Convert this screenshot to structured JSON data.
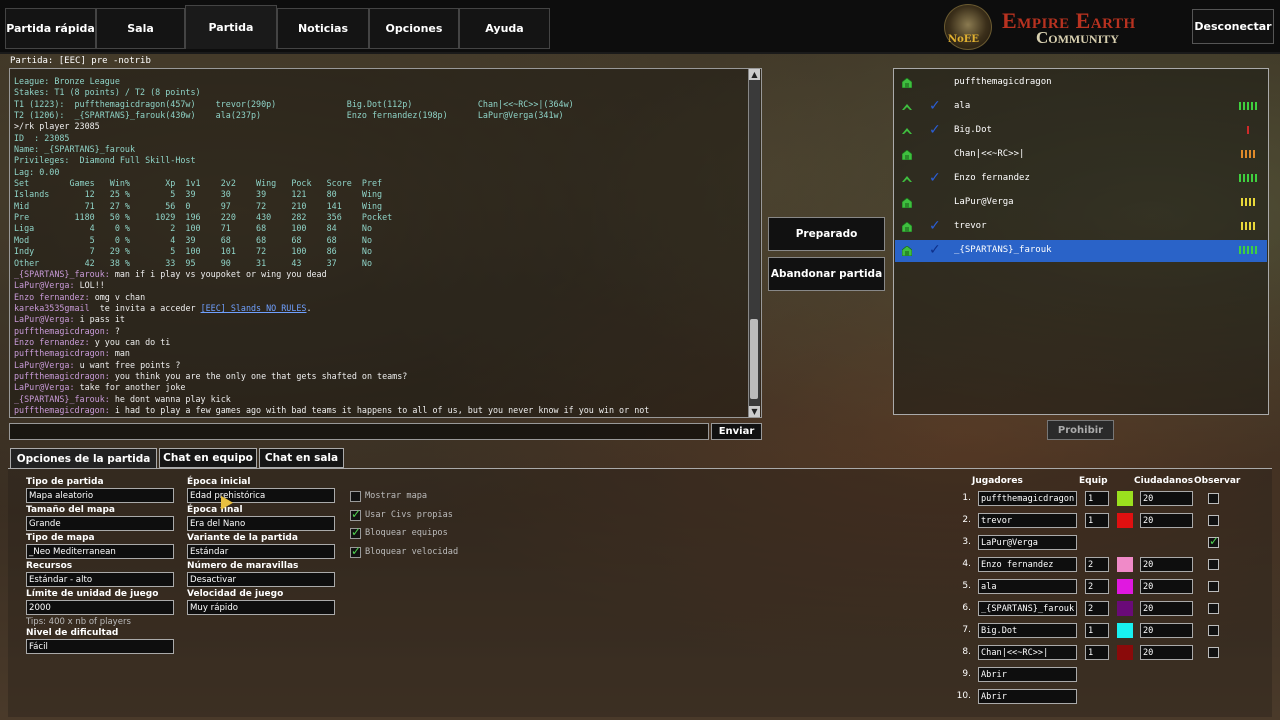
{
  "nav": {
    "tabs": [
      "Partida rápida",
      "Sala",
      "Partida",
      "Noticias",
      "Opciones",
      "Ayuda"
    ],
    "active_tab": "Partida",
    "logo_line1": "Empire Earth",
    "logo_line2": "Community",
    "logo_badge": "NoEE",
    "disconnect_label": "Desconectar"
  },
  "chat": {
    "title": "Partida: [EEC] pre -notrib",
    "lines": [
      [
        [
          "sys",
          "League: Bronze League"
        ]
      ],
      [
        [
          "sys",
          "Stakes: T1 (8 points) / T2 (8 points)"
        ]
      ],
      [
        [
          "sys",
          "T1 (1223):  puffthemagicdragon(457w)    trevor(290p)              Big.Dot(112p)             Chan|<<~RC>>|(364w)"
        ]
      ],
      [
        [
          "sys",
          "T2 (1206):  _{SPARTANS}_farouk(430w)    ala(237p)                 Enzo fernandez(198p)      LaPur@Verga(341w)"
        ]
      ],
      [
        [
          "msg",
          ">/rk player 23085"
        ]
      ],
      [
        [
          "sys",
          "ID  : 23085"
        ]
      ],
      [
        [
          "sys",
          "Name: _{SPARTANS}_farouk"
        ]
      ],
      [
        [
          "sys",
          "Privileges:  Diamond Full Skill-Host"
        ]
      ],
      [
        [
          "sys",
          "Lag: 0.00"
        ]
      ],
      [
        [
          "sys",
          "Set        Games   Win%       Xp  1v1    2v2    Wing   Pock   Score  Pref"
        ]
      ],
      [
        [
          "sys",
          "Islands       12   25 %        5  39     30     39     121    80     Wing"
        ]
      ],
      [
        [
          "sys",
          "Mid           71   27 %       56  0      97     72     210    141    Wing"
        ]
      ],
      [
        [
          "sys",
          "Pre         1180   50 %     1029  196    220    430    282    356    Pocket"
        ]
      ],
      [
        [
          "sys",
          "Liga           4    0 %        2  100    71     68     100    84     No"
        ]
      ],
      [
        [
          "sys",
          "Mod            5    0 %        4  39     68     68     68     68     No"
        ]
      ],
      [
        [
          "sys",
          "Indy           7   29 %        5  100    101    72     100    86     No"
        ]
      ],
      [
        [
          "sys",
          "Other         42   38 %       33  95     90     31     43     37     No"
        ]
      ],
      [
        [
          "nick",
          "_{SPARTANS}_farouk: "
        ],
        [
          "msg",
          "man if i play vs youpoket or wing you dead"
        ]
      ],
      [
        [
          "nick",
          "LaPur@Verga: "
        ],
        [
          "msg",
          "LOL!!"
        ]
      ],
      [
        [
          "nick",
          "Enzo fernandez: "
        ],
        [
          "msg",
          "omg v chan"
        ]
      ],
      [
        [
          "nick",
          "kareka3535gmail "
        ],
        [
          "msg",
          " te invita a acceder "
        ],
        [
          "link",
          "[EEC] Slands NO RULES"
        ],
        [
          "msg",
          "."
        ]
      ],
      [
        [
          "nick",
          "LaPur@Verga: "
        ],
        [
          "msg",
          "i pass it"
        ]
      ],
      [
        [
          "nick",
          "puffthemagicdragon: "
        ],
        [
          "msg",
          "?"
        ]
      ],
      [
        [
          "nick",
          "Enzo fernandez: "
        ],
        [
          "msg",
          "y you can do ti"
        ]
      ],
      [
        [
          "nick",
          "puffthemagicdragon: "
        ],
        [
          "msg",
          "man"
        ]
      ],
      [
        [
          "nick",
          "LaPur@Verga: "
        ],
        [
          "msg",
          "u want free points ?"
        ]
      ],
      [
        [
          "nick",
          "puffthemagicdragon: "
        ],
        [
          "msg",
          "you think you are the only one that gets shafted on teams?"
        ]
      ],
      [
        [
          "nick",
          "LaPur@Verga: "
        ],
        [
          "msg",
          "take for another joke"
        ]
      ],
      [
        [
          "nick",
          "_{SPARTANS}_farouk: "
        ],
        [
          "msg",
          "he dont wanna play kick"
        ]
      ],
      [
        [
          "nick",
          "puffthemagicdragon: "
        ],
        [
          "msg",
          "i had to play a few games ago with bad teams it happens to all of us, but you never know if you win or not"
        ]
      ]
    ],
    "input_value": "",
    "send_label": "Enviar"
  },
  "actions": {
    "ready_label": "Preparado",
    "leave_label": "Abandonar partida",
    "prohibit_label": "Prohibir"
  },
  "players": [
    {
      "name": "puffthemagicdragon",
      "icon": "host",
      "checked": false,
      "bars": "",
      "bar_color": ""
    },
    {
      "name": "ala",
      "icon": "peer",
      "checked": true,
      "bars": "5",
      "bar_color": "#3fd03f"
    },
    {
      "name": "Big.Dot",
      "icon": "peer",
      "checked": true,
      "bars": "1",
      "bar_color": "#d02a2a"
    },
    {
      "name": "Chan|<<~RC>>|",
      "icon": "host",
      "checked": false,
      "bars": "4",
      "bar_color": "#e08a2a"
    },
    {
      "name": "Enzo fernandez",
      "icon": "peer",
      "checked": true,
      "bars": "5",
      "bar_color": "#3fd03f"
    },
    {
      "name": "LaPur@Verga",
      "icon": "host",
      "checked": false,
      "bars": "4",
      "bar_color": "#e8d83a"
    },
    {
      "name": "trevor",
      "icon": "host",
      "checked": true,
      "bars": "4",
      "bar_color": "#e8d83a"
    },
    {
      "name": "_{SPARTANS}_farouk",
      "icon": "host",
      "checked": true,
      "bars": "5",
      "bar_color": "#3fd03f",
      "selected": true
    }
  ],
  "bottom_tabs": [
    "Opciones de la partida",
    "Chat en equipo",
    "Chat en sala"
  ],
  "options": {
    "col1": [
      {
        "label": "Tipo de partida",
        "value": "Mapa aleatorio"
      },
      {
        "label": "Tamaño del mapa",
        "value": "Grande"
      },
      {
        "label": "Tipo de mapa",
        "value": "_Neo Mediterranean"
      },
      {
        "label": "Recursos",
        "value": "Estándar - alto"
      },
      {
        "label": "Límite de unidad de juego",
        "value": "2000"
      },
      {
        "label": "Nivel de dificultad",
        "value": "Fácil"
      }
    ],
    "tips": "Tips: 400 x nb of players",
    "col2": [
      {
        "label": "Época inicial",
        "value": "Edad prehistórica"
      },
      {
        "label": "Época final",
        "value": "Era del Nano"
      },
      {
        "label": "Variante de la partida",
        "value": "Estándar"
      },
      {
        "label": "Número de maravillas",
        "value": "Desactivar"
      },
      {
        "label": "Velocidad de juego",
        "value": "Muy rápido"
      }
    ],
    "checks": [
      {
        "label": "Mostrar mapa",
        "checked": false
      },
      {
        "label": "Usar Civs propias",
        "checked": true
      },
      {
        "label": "Bloquear equipos",
        "checked": true
      },
      {
        "label": "Bloquear velocidad",
        "checked": true
      }
    ]
  },
  "roster": {
    "headers": {
      "players": "Jugadores",
      "team": "Equip",
      "citizens": "Ciudadanos",
      "observe": "Observar"
    },
    "rows": [
      {
        "num": "1.",
        "name": "puffthemagicdragon",
        "team": "1",
        "color": "#9be01e",
        "pop": "20",
        "observe": false
      },
      {
        "num": "2.",
        "name": "trevor",
        "team": "1",
        "color": "#e01010",
        "pop": "20",
        "observe": false
      },
      {
        "num": "3.",
        "name": "LaPur@Verga",
        "team": "",
        "color": "",
        "pop": "",
        "observe": true
      },
      {
        "num": "4.",
        "name": "Enzo fernandez",
        "team": "2",
        "color": "#f08ac8",
        "pop": "20",
        "observe": false
      },
      {
        "num": "5.",
        "name": "ala",
        "team": "2",
        "color": "#e018e0",
        "pop": "20",
        "observe": false
      },
      {
        "num": "6.",
        "name": "_{SPARTANS}_farouk",
        "team": "2",
        "color": "#6a0a78",
        "pop": "20",
        "observe": false
      },
      {
        "num": "7.",
        "name": "Big.Dot",
        "team": "1",
        "color": "#18f0f0",
        "pop": "20",
        "observe": false
      },
      {
        "num": "8.",
        "name": "Chan|<<~RC>>|",
        "team": "1",
        "color": "#8a0a0a",
        "pop": "20",
        "observe": false
      },
      {
        "num": "9.",
        "name": "Abrir",
        "team": "",
        "color": "",
        "pop": "",
        "observe": null
      },
      {
        "num": "10.",
        "name": "Abrir",
        "team": "",
        "color": "",
        "pop": "",
        "observe": null
      }
    ]
  }
}
